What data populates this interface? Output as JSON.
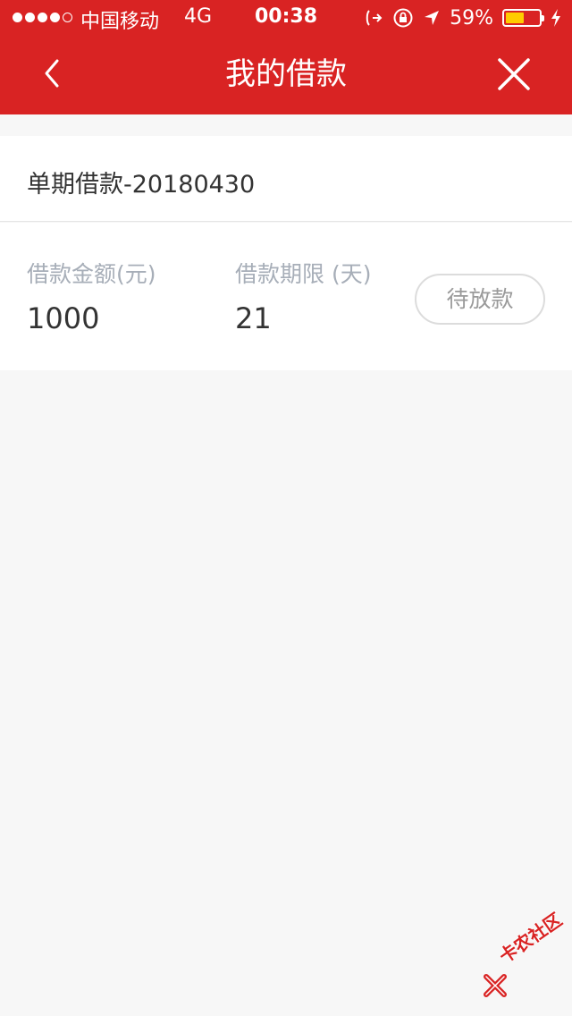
{
  "status_bar": {
    "carrier": "中国移动",
    "network": "4G",
    "time": "00:38",
    "battery_percent": "59%",
    "battery_level": 0.59,
    "signal_bars_filled": 4,
    "signal_bars_total": 5
  },
  "header": {
    "title": "我的借款",
    "background_color": "#d92323"
  },
  "loan": {
    "name": "单期借款-20180430",
    "amount_label": "借款金额(元)",
    "amount_value": "1000",
    "term_label": "借款期限 (天)",
    "term_value": "21",
    "status": "待放款"
  },
  "watermark": {
    "text": "卡农社区"
  }
}
